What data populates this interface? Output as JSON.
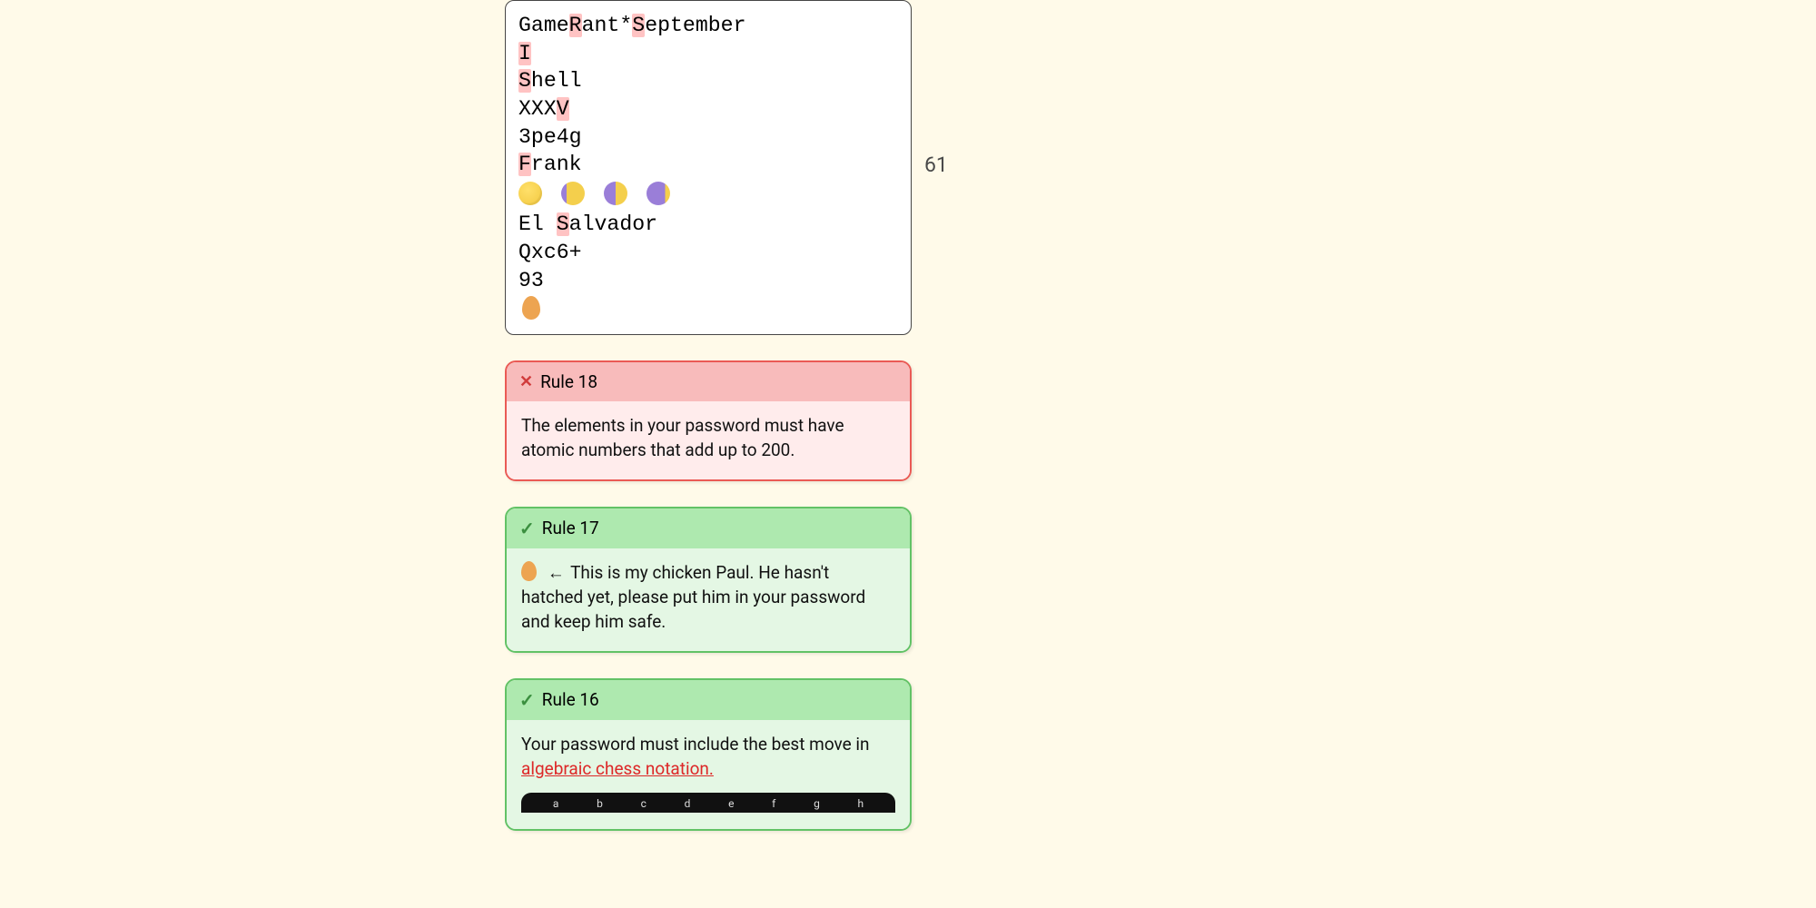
{
  "password": {
    "line1_plain_prefix": "Game",
    "line1_hl1": "R",
    "line1_mid1": "ant*",
    "line1_hl2": "S",
    "line1_mid2": "eptember",
    "line2_hl": "I",
    "line3_hl": "S",
    "line3_rest": "hell",
    "line4_plain": "XXX",
    "line4_hl": "V",
    "line5": "3pe4g",
    "line6_hl": "F",
    "line6_rest": "rank",
    "line8a": "El ",
    "line8_hl": "S",
    "line8b": "alvador",
    "line9": "Qxc6+",
    "line10": "93"
  },
  "char_count": "61",
  "rules": {
    "r18": {
      "label": "Rule 18",
      "text": "The elements in your password must have atomic numbers that add up to 200."
    },
    "r17": {
      "label": "Rule 17",
      "arrow": "←",
      "text": "This is my chicken Paul. He hasn't hatched yet, please put him in your password and keep him safe."
    },
    "r16": {
      "label": "Rule 16",
      "text_before": "Your password must include the best move in ",
      "link": "algebraic chess notation.",
      "files": [
        "a",
        "b",
        "c",
        "d",
        "e",
        "f",
        "g",
        "h"
      ]
    }
  }
}
